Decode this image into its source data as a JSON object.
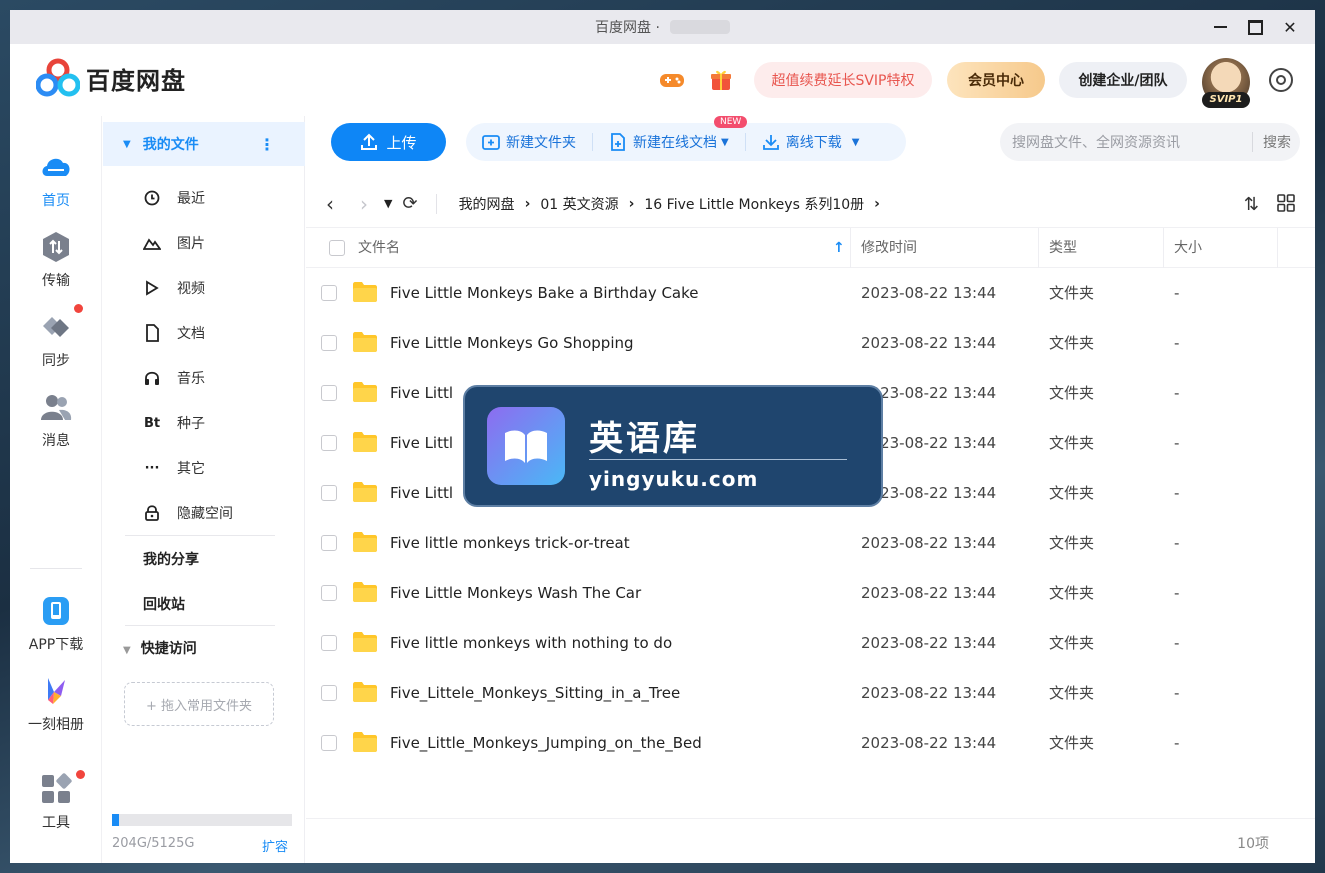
{
  "titlebar": {
    "title": "百度网盘 ·"
  },
  "header": {
    "app_name": "百度网盘",
    "promo": "超值续费延长SVIP特权",
    "vip_center": "会员中心",
    "create_team": "创建企业/团队",
    "avatar_badge": "SVIP1"
  },
  "rail": {
    "items": [
      {
        "label": "首页",
        "icon": "cloud-icon"
      },
      {
        "label": "传输",
        "icon": "transfer-icon"
      },
      {
        "label": "同步",
        "icon": "sync-icon"
      },
      {
        "label": "消息",
        "icon": "contacts-icon"
      },
      {
        "label": "APP下载",
        "icon": "phone-icon"
      },
      {
        "label": "一刻相册",
        "icon": "album-icon"
      },
      {
        "label": "工具",
        "icon": "tools-icon"
      }
    ]
  },
  "nav": {
    "my_files": "我的文件",
    "items": [
      {
        "label": "最近",
        "icon": "clock-icon"
      },
      {
        "label": "图片",
        "icon": "image-icon"
      },
      {
        "label": "视频",
        "icon": "play-icon"
      },
      {
        "label": "文档",
        "icon": "document-icon"
      },
      {
        "label": "音乐",
        "icon": "headphones-icon"
      },
      {
        "label": "种子",
        "icon": "bt-icon"
      },
      {
        "label": "其它",
        "icon": "more-icon"
      },
      {
        "label": "隐藏空间",
        "icon": "lock-icon"
      }
    ],
    "my_share": "我的分享",
    "recycle": "回收站",
    "quick_access": "快捷访问",
    "drop_hint": "+ 拖入常用文件夹",
    "storage_text": "204G/5125G",
    "storage_used_fraction": 0.04,
    "expand": "扩容"
  },
  "toolbar": {
    "upload": "上传",
    "new_folder": "新建文件夹",
    "new_online_doc": "新建在线文档",
    "new_tag": "NEW",
    "offline_download": "离线下载",
    "search_placeholder": "搜网盘文件、全网资源资讯",
    "search_button": "搜索"
  },
  "breadcrumb": [
    "我的网盘",
    "01 英文资源",
    "16 Five Little Monkeys 系列10册"
  ],
  "table": {
    "headers": {
      "name": "文件名",
      "time": "修改时间",
      "type": "类型",
      "size": "大小"
    },
    "rows": [
      {
        "name": "Five Little Monkeys Bake a Birthday Cake",
        "time": "2023-08-22 13:44",
        "type": "文件夹",
        "size": "-"
      },
      {
        "name": "Five Little Monkeys Go Shopping",
        "time": "2023-08-22 13:44",
        "type": "文件夹",
        "size": "-"
      },
      {
        "name": "Five Littl",
        "time": "2023-08-22 13:44",
        "type": "文件夹",
        "size": "-"
      },
      {
        "name": "Five Littl",
        "time": "2023-08-22 13:44",
        "type": "文件夹",
        "size": "-"
      },
      {
        "name": "Five Littl",
        "time": "2023-08-22 13:44",
        "type": "文件夹",
        "size": "-"
      },
      {
        "name": "Five little monkeys trick-or-treat",
        "time": "2023-08-22 13:44",
        "type": "文件夹",
        "size": "-"
      },
      {
        "name": "Five Little Monkeys Wash The Car",
        "time": "2023-08-22 13:44",
        "type": "文件夹",
        "size": "-"
      },
      {
        "name": "Five little monkeys with nothing to do",
        "time": "2023-08-22 13:44",
        "type": "文件夹",
        "size": "-"
      },
      {
        "name": "Five_Littele_Monkeys_Sitting_in_a_Tree",
        "time": "2023-08-22 13:44",
        "type": "文件夹",
        "size": "-"
      },
      {
        "name": "Five_Little_Monkeys_Jumping_on_the_Bed",
        "time": "2023-08-22 13:44",
        "type": "文件夹",
        "size": "-"
      }
    ],
    "count": "10项"
  },
  "watermark": {
    "title": "英语库",
    "url": "yingyuku.com"
  },
  "colors": {
    "accent": "#1a8cf5",
    "folder": "#ffc629",
    "promo": "#e8554e"
  }
}
